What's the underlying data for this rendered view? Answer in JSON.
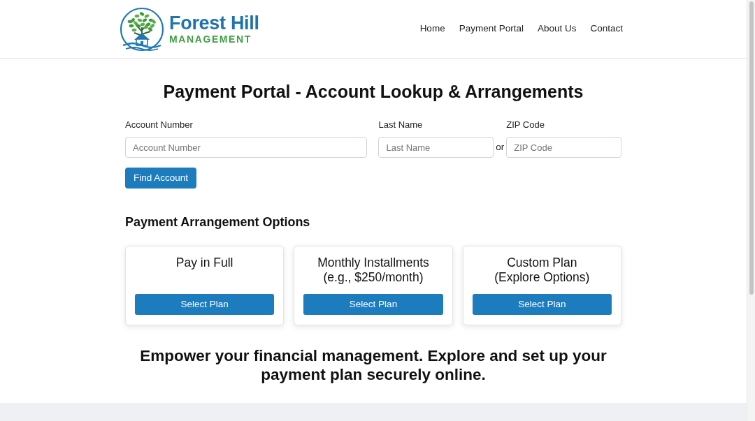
{
  "header": {
    "logo": {
      "name": "Forest Hill",
      "subtitle": "MANAGEMENT"
    },
    "nav": [
      {
        "label": "Home"
      },
      {
        "label": "Payment Portal"
      },
      {
        "label": "About Us"
      },
      {
        "label": "Contact"
      }
    ]
  },
  "lookup": {
    "title": "Payment Portal - Account Lookup & Arrangements",
    "fields": [
      {
        "kind": "wide",
        "label": "Account Number",
        "placeholder": "Account Number"
      },
      {
        "kind": "narrow",
        "label": "Last Name",
        "placeholder": "Last Name"
      },
      {
        "kind": "narrow",
        "label": "ZIP Code",
        "placeholder": "ZIP Code"
      }
    ],
    "separator": "or",
    "button": "Find Account"
  },
  "options": {
    "heading": "Payment Arrangement Options",
    "plans": [
      {
        "title_lines": [
          "Pay in Full"
        ],
        "button": "Select Plan"
      },
      {
        "title_lines": [
          "Monthly Installments",
          "(e.g., $250/month)"
        ],
        "button": "Select Plan"
      },
      {
        "title_lines": [
          "Custom Plan",
          "(Explore Options)"
        ],
        "button": "Select Plan"
      }
    ]
  },
  "tagline": "Empower your financial management. Explore and set up your payment plan securely online."
}
